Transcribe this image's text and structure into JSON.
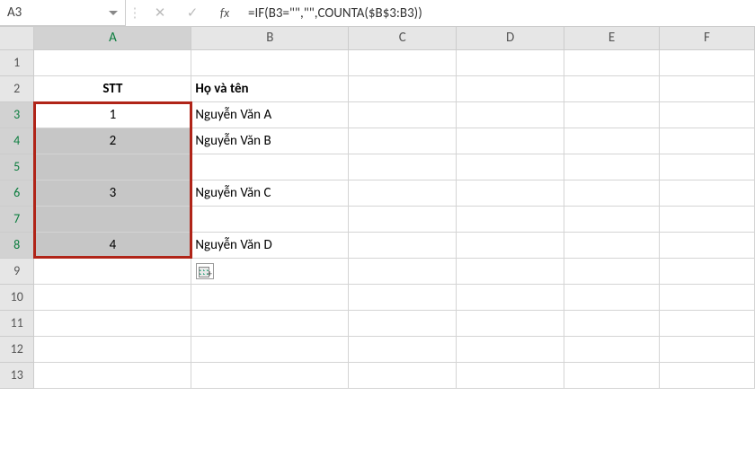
{
  "name_box": "A3",
  "formula": "=IF(B3=\"\",\"\",COUNTA($B$3:B3))",
  "cancel_glyph": "✕",
  "enter_glyph": "✓",
  "fx_label": "fx",
  "columns": [
    "A",
    "B",
    "C",
    "D",
    "E",
    "F"
  ],
  "row_numbers": [
    "1",
    "2",
    "3",
    "4",
    "5",
    "6",
    "7",
    "8",
    "9",
    "10",
    "11",
    "12",
    "13"
  ],
  "headers": {
    "stt": "STT",
    "name": "Họ và tên"
  },
  "rows": {
    "r3": {
      "stt": "1",
      "name": "Nguyễn Văn A"
    },
    "r4": {
      "stt": "2",
      "name": "Nguyễn Văn B"
    },
    "r5": {
      "stt": "",
      "name": ""
    },
    "r6": {
      "stt": "3",
      "name": "Nguyễn Văn C"
    },
    "r7": {
      "stt": "",
      "name": ""
    },
    "r8": {
      "stt": "4",
      "name": "Nguyễn Văn D"
    }
  },
  "chart_data": {
    "type": "table",
    "title": "",
    "columns": [
      "STT",
      "Họ và tên"
    ],
    "rows": [
      [
        "1",
        "Nguyễn Văn A"
      ],
      [
        "2",
        "Nguyễn Văn B"
      ],
      [
        "",
        ""
      ],
      [
        "3",
        "Nguyễn Văn C"
      ],
      [
        "",
        ""
      ],
      [
        "4",
        "Nguyễn Văn D"
      ]
    ]
  }
}
